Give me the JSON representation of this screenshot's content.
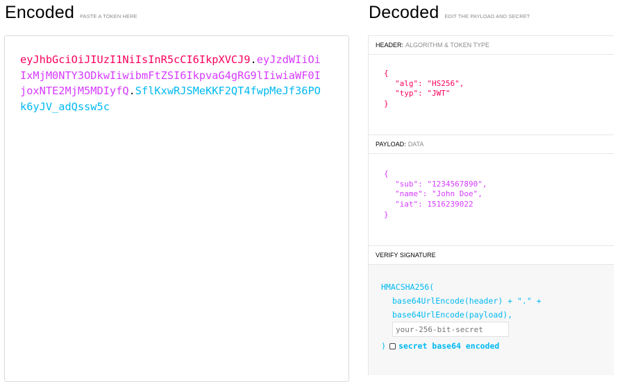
{
  "encoded": {
    "title": "Encoded",
    "subtitle": "PASTE A TOKEN HERE",
    "token": {
      "header": "eyJhbGciOiJIUzI1NiIsInR5cCI6IkpXVCJ9",
      "payload": "eyJzdWIiOiIxMjM0NTY3ODkwIiwibmFtZSI6IkpvaG4gRG9lIiwiaWF0IjoxNTE2MjM5MDIyfQ",
      "signature": "SflKxwRJSMeKKF2QT4fwpMeJf36POk6yJV_adQssw5c",
      "dot": "."
    }
  },
  "decoded": {
    "title": "Decoded",
    "subtitle": "EDIT THE PAYLOAD AND SECRET",
    "header_section": {
      "label": "HEADER:",
      "sublabel": "ALGORITHM & TOKEN TYPE",
      "lines": [
        "{",
        "\"alg\": \"HS256\",",
        "\"typ\": \"JWT\"",
        "}"
      ]
    },
    "payload_section": {
      "label": "PAYLOAD:",
      "sublabel": "DATA",
      "lines": [
        "{",
        "\"sub\": \"1234567890\",",
        "\"name\": \"John Doe\",",
        "\"iat\": 1516239022",
        "}"
      ]
    },
    "verify_section": {
      "label": "VERIFY SIGNATURE",
      "func": "HMACSHA256(",
      "line1": "base64UrlEncode(header) + \".\" +",
      "line2": "base64UrlEncode(payload),",
      "secret_placeholder": "your-256-bit-secret",
      "close": ")",
      "checkbox_label": "secret base64 encoded"
    }
  },
  "colors": {
    "header": "#fb015b",
    "payload": "#d63aff",
    "signature": "#00b9f1"
  }
}
